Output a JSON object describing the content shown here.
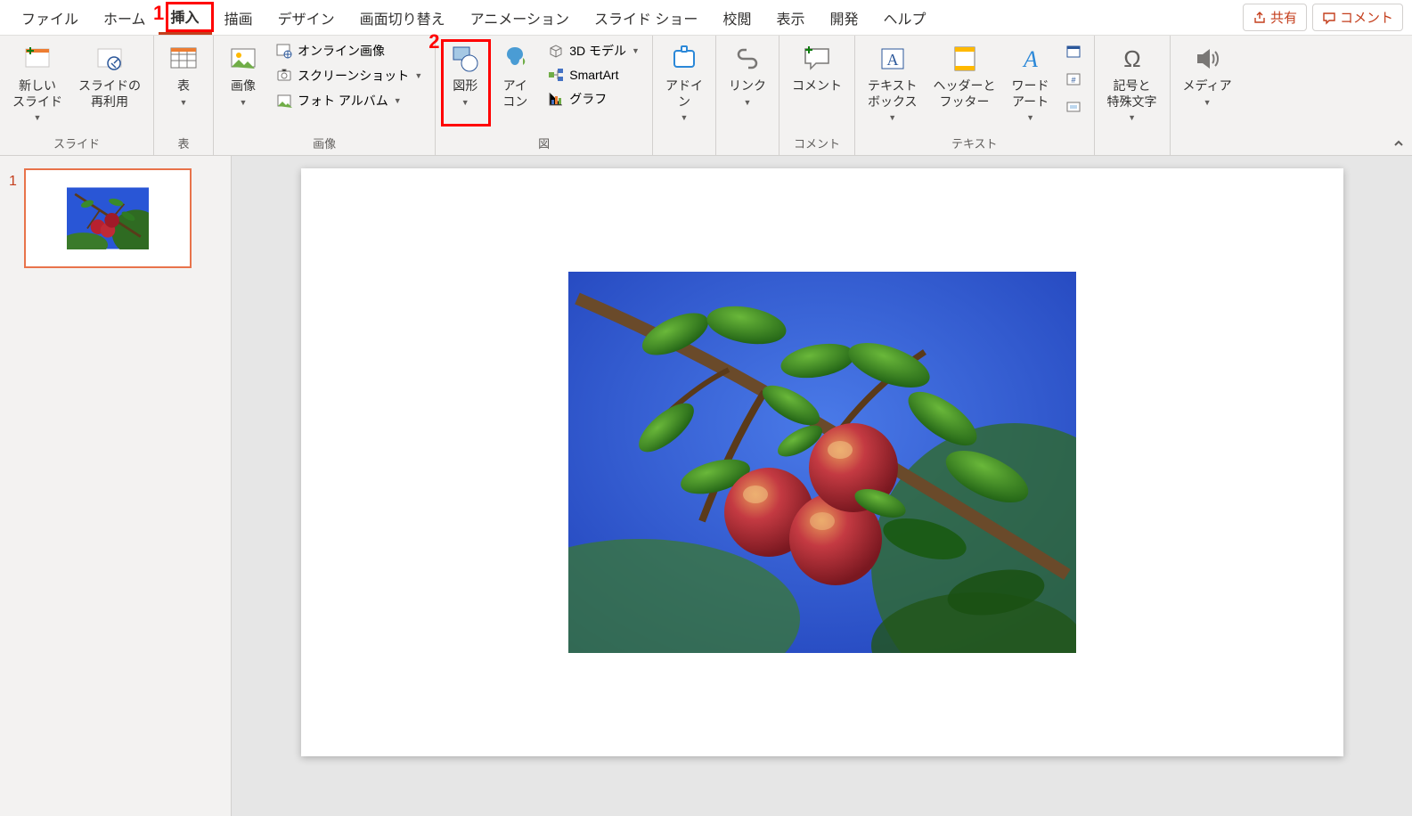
{
  "tabs": {
    "file": "ファイル",
    "home": "ホーム",
    "insert": "挿入",
    "draw": "描画",
    "design": "デザイン",
    "transitions": "画面切り替え",
    "animations": "アニメーション",
    "slideshow": "スライド ショー",
    "review": "校閲",
    "view": "表示",
    "developer": "開発",
    "help": "ヘルプ"
  },
  "actions": {
    "share": "共有",
    "comment": "コメント"
  },
  "annotations": {
    "one": "1",
    "two": "2"
  },
  "groups": {
    "slide": {
      "label": "スライド",
      "new_slide": "新しい\nスライド",
      "reuse": "スライドの\n再利用"
    },
    "table": {
      "label": "表",
      "table": "表"
    },
    "images": {
      "label": "画像",
      "pictures": "画像",
      "online": "オンライン画像",
      "screenshot": "スクリーンショット",
      "album": "フォト アルバム"
    },
    "illustrations": {
      "label": "図",
      "shapes": "図形",
      "icons": "アイ\nコン",
      "models3d": "3D モデル",
      "smartart": "SmartArt",
      "chart": "グラフ"
    },
    "addins": {
      "label": "",
      "addins": "アドイ\nン"
    },
    "links": {
      "label": "",
      "link": "リンク"
    },
    "comments": {
      "label": "コメント",
      "comment": "コメント"
    },
    "text": {
      "label": "テキスト",
      "textbox": "テキスト\nボックス",
      "headerfooter": "ヘッダーと\nフッター",
      "wordart": "ワード\nアート"
    },
    "symbols": {
      "label": "",
      "symbols": "記号と\n特殊文字"
    },
    "media": {
      "label": "",
      "media": "メディア"
    }
  },
  "thumbnails": {
    "num1": "1"
  }
}
